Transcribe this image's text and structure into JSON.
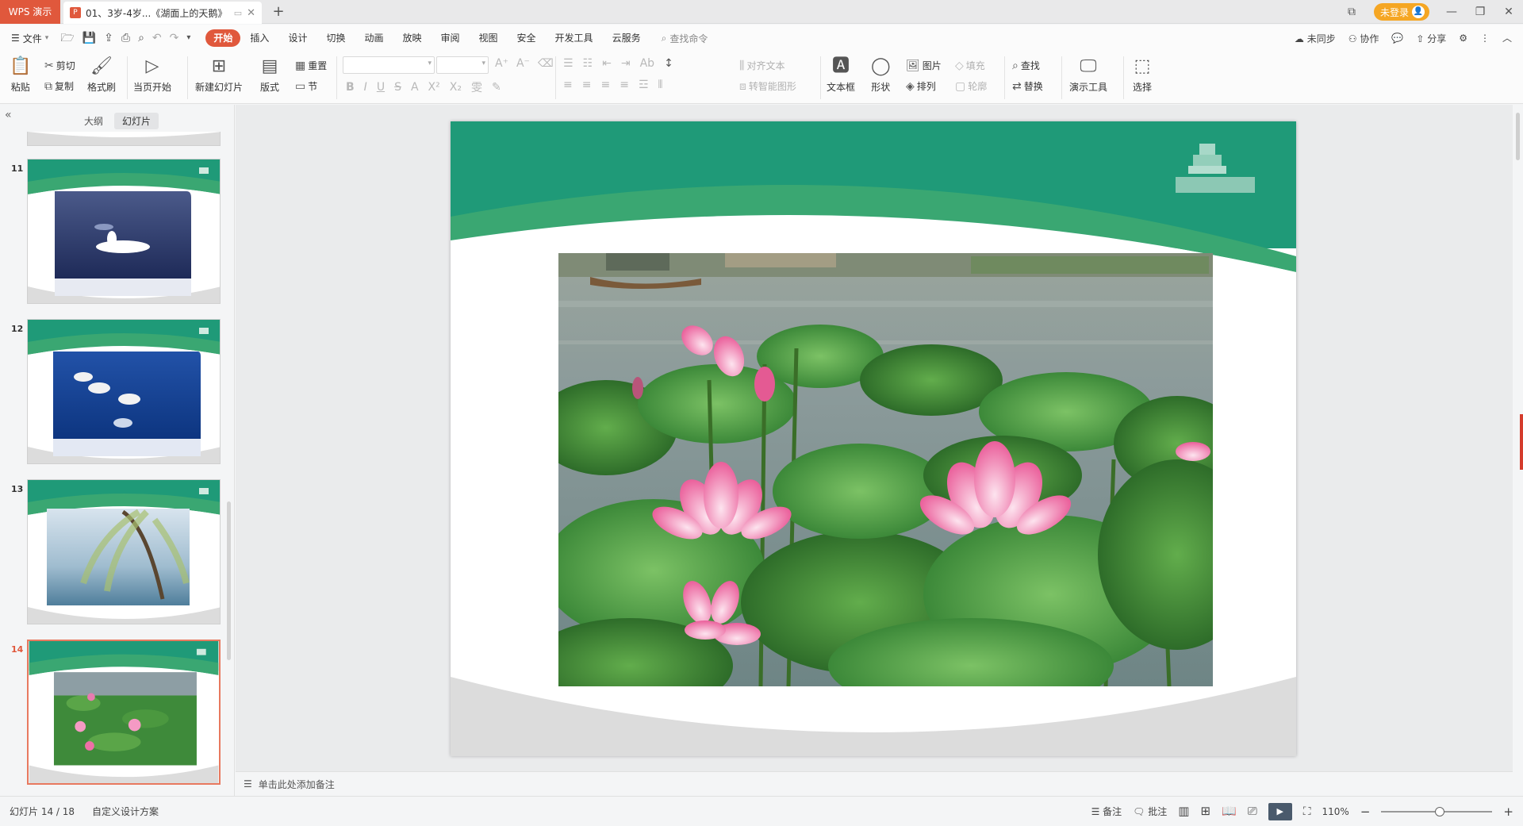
{
  "titlebar": {
    "app_name": "WPS 演示",
    "doc_title": "01、3岁-4岁...《湖面上的天鹅》",
    "new_tab": "+",
    "login_label": "未登录"
  },
  "menubar": {
    "file_label": "文件",
    "tabs": [
      "开始",
      "插入",
      "设计",
      "切换",
      "动画",
      "放映",
      "审阅",
      "视图",
      "安全",
      "开发工具",
      "云服务"
    ],
    "search_label": "查找命令",
    "right": {
      "sync": "未同步",
      "collab": "协作",
      "share": "分享"
    }
  },
  "ribbon": {
    "paste": "粘贴",
    "cut": "剪切",
    "copy": "复制",
    "format_painter": "格式刷",
    "from_current": "当页开始",
    "new_slide": "新建幻灯片",
    "layout": "版式",
    "reset": "重置",
    "section": "节",
    "align_text": "对齐文本",
    "smartart": "转智能图形",
    "textbox": "文本框",
    "shapes": "形状",
    "picture": "图片",
    "arrange": "排列",
    "fill": "填充",
    "outline": "轮廓",
    "find": "查找",
    "replace": "替换",
    "present_tools": "演示工具",
    "select": "选择"
  },
  "leftpanel": {
    "tab_outline": "大纲",
    "tab_slides": "幻灯片",
    "thumbnails": [
      {
        "num": "11",
        "scene": "swans-mist"
      },
      {
        "num": "12",
        "scene": "swans-blue"
      },
      {
        "num": "13",
        "scene": "willow-lake"
      },
      {
        "num": "14",
        "scene": "lotus"
      }
    ],
    "selected_num": "14"
  },
  "notes": {
    "placeholder": "单击此处添加备注"
  },
  "statusbar": {
    "slide_counter": "幻灯片 14 / 18",
    "design_scheme": "自定义设计方案",
    "notes_btn": "备注",
    "comments_btn": "批注",
    "zoom": "110%",
    "zoom_in": "+",
    "zoom_out": "−"
  },
  "colors": {
    "brand": "#e0583c",
    "slide_green": "#1f9a78",
    "slide_green_light": "#3aa772",
    "slide_gray": "#dcdcdc"
  }
}
